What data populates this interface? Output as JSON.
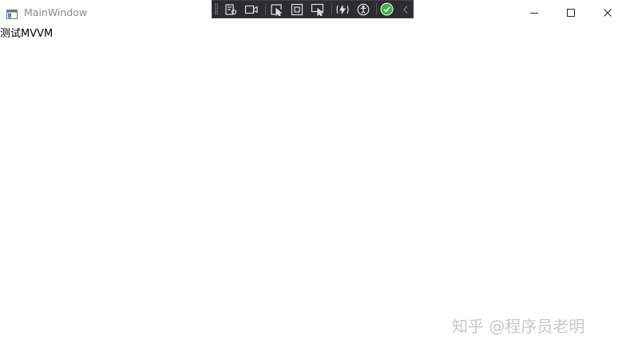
{
  "window": {
    "title": "MainWindow"
  },
  "titlebar_buttons": {
    "minimize_icon": "minimize-icon",
    "maximize_icon": "maximize-icon",
    "close_icon": "close-icon"
  },
  "debug_toolbar": {
    "buttons": [
      {
        "name": "live-visual-tree-icon"
      },
      {
        "name": "record-icon"
      },
      {
        "name": "select-element-icon"
      },
      {
        "name": "display-layout-adorners-icon"
      },
      {
        "name": "track-focused-element-icon"
      },
      {
        "name": "hot-reload-icon"
      },
      {
        "name": "accessibility-checker-icon"
      },
      {
        "name": "hot-reload-status-icon"
      },
      {
        "name": "collapse-toolbar-icon"
      }
    ],
    "accent_color": "#3cb44b"
  },
  "content": {
    "text": "测试MVVM"
  },
  "overlay": {
    "watermark": "知乎 @程序员老明"
  }
}
